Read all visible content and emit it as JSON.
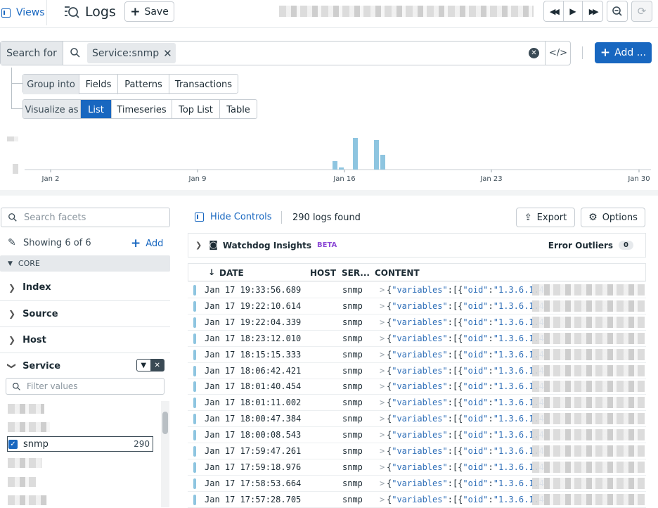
{
  "topbar": {
    "views_label": "Views",
    "title": "Logs",
    "save_label": "Save"
  },
  "search": {
    "label": "Search for",
    "chip": "Service:snmp",
    "add_label": "Add ..."
  },
  "group_into": {
    "label": "Group into",
    "options": [
      "Fields",
      "Patterns",
      "Transactions"
    ]
  },
  "visualize_as": {
    "label": "Visualize as",
    "options": [
      "List",
      "Timeseries",
      "Top List",
      "Table"
    ],
    "selected": "List"
  },
  "chart_data": {
    "type": "bar",
    "x_ticks": [
      "Jan 2",
      "Jan 9",
      "Jan 16",
      "Jan 23",
      "Jan 30"
    ],
    "bar_color": "#8ec5e0"
  },
  "controls": {
    "hide_label": "Hide Controls",
    "count_text": "290 logs found",
    "export_label": "Export",
    "options_label": "Options"
  },
  "watchdog": {
    "title": "Watchdog Insights",
    "beta": "BETA",
    "error_outliers_label": "Error Outliers",
    "error_outliers_count": "0"
  },
  "facets": {
    "search_placeholder": "Search facets",
    "showing": "Showing 6 of 6",
    "add_label": "Add",
    "core_label": "CORE",
    "groups": [
      "Index",
      "Source",
      "Host",
      "Service"
    ],
    "filter_placeholder": "Filter values",
    "selected_value": {
      "name": "snmp",
      "count": "290"
    }
  },
  "table": {
    "headers": [
      "DATE",
      "HOST",
      "SER...",
      "CONTENT"
    ],
    "content_prefix": "{",
    "content_key1": "\"variables\"",
    "content_mid": ":[{",
    "content_key2": "\"oid\"",
    "content_mid2": ":",
    "content_val": "\"1.3.6.1.4",
    "rows": [
      {
        "date": "Jan 17 19:33:56.689",
        "service": "snmp"
      },
      {
        "date": "Jan 17 19:22:10.614",
        "service": "snmp"
      },
      {
        "date": "Jan 17 19:22:04.339",
        "service": "snmp"
      },
      {
        "date": "Jan 17 18:23:12.010",
        "service": "snmp"
      },
      {
        "date": "Jan 17 18:15:15.333",
        "service": "snmp"
      },
      {
        "date": "Jan 17 18:06:42.421",
        "service": "snmp"
      },
      {
        "date": "Jan 17 18:01:40.454",
        "service": "snmp"
      },
      {
        "date": "Jan 17 18:01:11.002",
        "service": "snmp"
      },
      {
        "date": "Jan 17 18:00:47.384",
        "service": "snmp"
      },
      {
        "date": "Jan 17 18:00:08.543",
        "service": "snmp"
      },
      {
        "date": "Jan 17 17:59:47.261",
        "service": "snmp"
      },
      {
        "date": "Jan 17 17:59:18.976",
        "service": "snmp"
      },
      {
        "date": "Jan 17 17:58:53.664",
        "service": "snmp"
      },
      {
        "date": "Jan 17 17:57:28.705",
        "service": "snmp"
      }
    ]
  }
}
